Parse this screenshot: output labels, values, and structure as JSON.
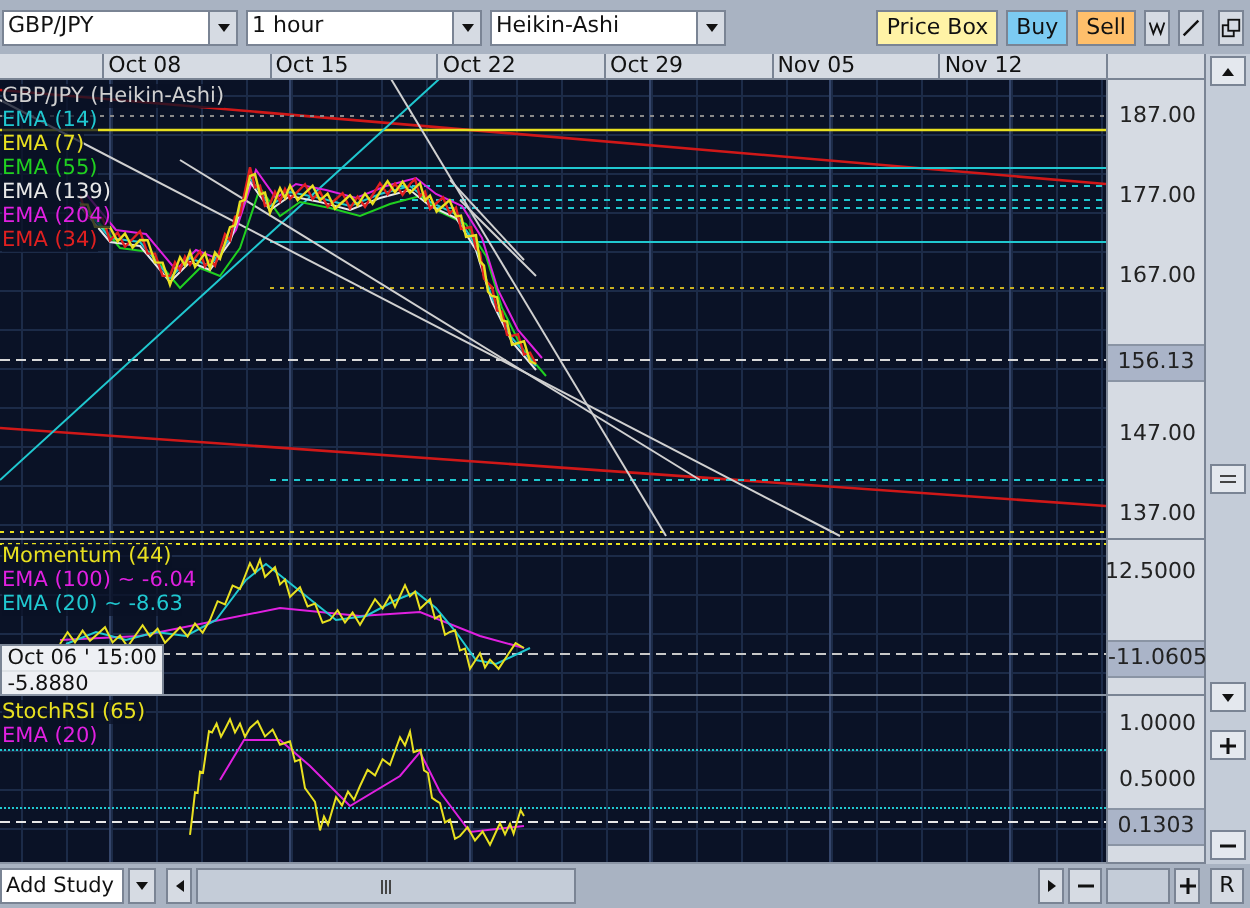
{
  "toolbar": {
    "symbol": "GBP/JPY",
    "interval": "1 hour",
    "chart_type": "Heikin-Ashi",
    "buttons": [
      {
        "label": "Price Box",
        "kind": "pricebox"
      },
      {
        "label": "Buy",
        "kind": "buy"
      },
      {
        "label": "Sell",
        "kind": "sell"
      }
    ]
  },
  "date_axis": [
    "Oct 08",
    "Oct 15",
    "Oct 22",
    "Oct 29",
    "Nov 05",
    "Nov 12"
  ],
  "main_panel": {
    "legend": [
      {
        "label": "GBP/JPY (Heikin-Ashi)",
        "color": "#d0d0d0"
      },
      {
        "label": "EMA (14)",
        "color": "#20c8d0"
      },
      {
        "label": "EMA (7)",
        "color": "#e8e020"
      },
      {
        "label": "EMA (55)",
        "color": "#20d020"
      },
      {
        "label": "EMA (139)",
        "color": "#e8e8e8"
      },
      {
        "label": "EMA (204)",
        "color": "#e020e0"
      },
      {
        "label": "EMA (34)",
        "color": "#e02020"
      }
    ],
    "ticks": [
      "187.00",
      "177.00",
      "167.00",
      "147.00",
      "137.00"
    ],
    "current_value": "156.13"
  },
  "momentum_panel": {
    "legend": [
      {
        "label": "Momentum (44)",
        "color": "#e8e020"
      },
      {
        "label": "EMA (100) ~ -6.04",
        "color": "#e020e0"
      },
      {
        "label": "EMA (20) ~ -8.63",
        "color": "#20c8d0"
      }
    ],
    "ticks": [
      "12.5000"
    ],
    "current_value": "-11.0605",
    "tooltip": {
      "date": "Oct 06 ' 15:00",
      "value": "-5.8880"
    }
  },
  "stoch_panel": {
    "legend": [
      {
        "label": "StochRSI (65)",
        "color": "#e8e020"
      },
      {
        "label": "EMA (20)",
        "color": "#e020e0"
      }
    ],
    "ticks": [
      "1.0000",
      "0.5000"
    ],
    "current_value": "0.1303"
  },
  "bottom_bar": {
    "add_study": "Add Study",
    "reset": "R"
  }
}
